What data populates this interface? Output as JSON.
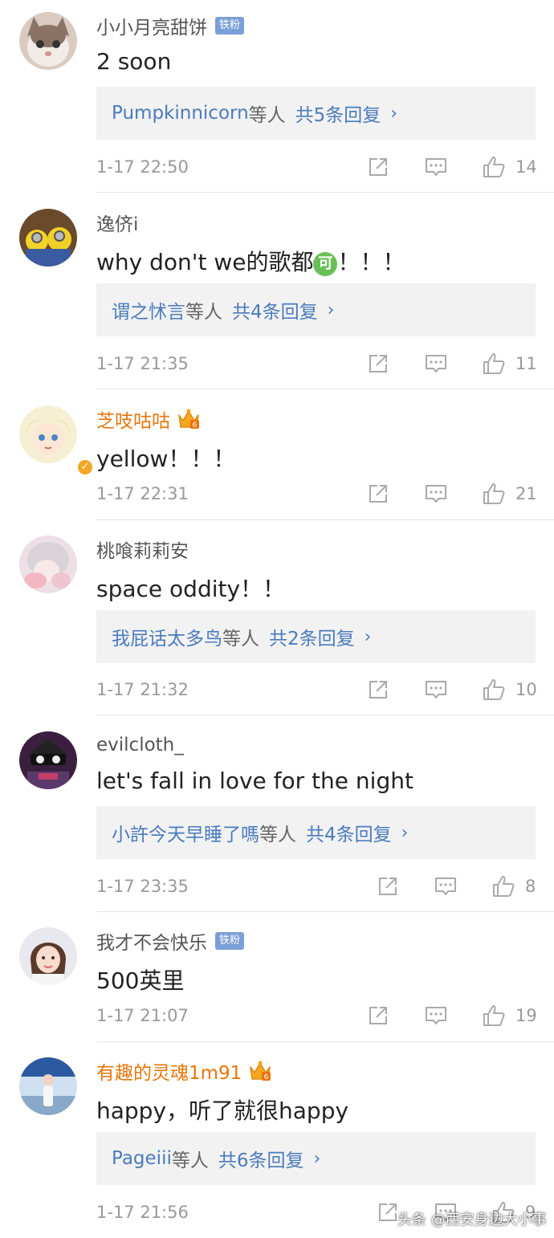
{
  "comments": [
    {
      "username": "小小月亮甜饼",
      "badge": "铁粉",
      "text": "2 soon",
      "reply": {
        "users": "Pumpkinnicorn",
        "suffix": "等人",
        "count": "共5条回复"
      },
      "time": "1-17 22:50",
      "likes": "14"
    },
    {
      "username": "逸侪i",
      "text": "why don't we的歌都",
      "emoji": "可",
      "text_after": "！！！",
      "reply": {
        "users": "谓之怵言",
        "suffix": "等人",
        "count": "共4条回复"
      },
      "time": "1-17 21:35",
      "likes": "11"
    },
    {
      "username": "芝吱咕咕",
      "text": "yellow！！！",
      "time": "1-17 22:31",
      "likes": "21"
    },
    {
      "username": "桃喰莉莉安",
      "text": "space oddity！！",
      "reply": {
        "users": "我屁话太多鸟",
        "suffix": "等人",
        "count": "共2条回复"
      },
      "time": "1-17 21:32",
      "likes": "10"
    },
    {
      "username": "evilcloth_",
      "text": "let's fall in love for the night",
      "reply": {
        "users": "小許今天早睡了嗎",
        "suffix": "等人",
        "count": "共4条回复"
      },
      "time": "1-17 23:35",
      "likes": "8"
    },
    {
      "username": "我才不会快乐",
      "badge": "铁粉",
      "text": "500英里",
      "time": "1-17 21:07",
      "likes": "19"
    },
    {
      "username": "有趣的灵魂1m91",
      "text": "happy，听了就很happy",
      "reply": {
        "users": "Pageiii",
        "suffix": "等人",
        "count": "共6条回复"
      },
      "time": "1-17 21:56",
      "likes": "9"
    }
  ],
  "watermark": "头条 @西安身边大小事",
  "icons": {
    "share": "share-icon",
    "comment": "comment-icon",
    "like": "thumbs-up-icon",
    "chevron": "chevron-right-icon",
    "crown": "vip-crown-icon"
  },
  "colors": {
    "username": "#555555",
    "vip_username": "#e8750b",
    "reply_link": "#4a7bbd",
    "reply_bg": "#f2f2f2",
    "meta_text": "#999999",
    "fan_badge": "#7a9ed6"
  }
}
